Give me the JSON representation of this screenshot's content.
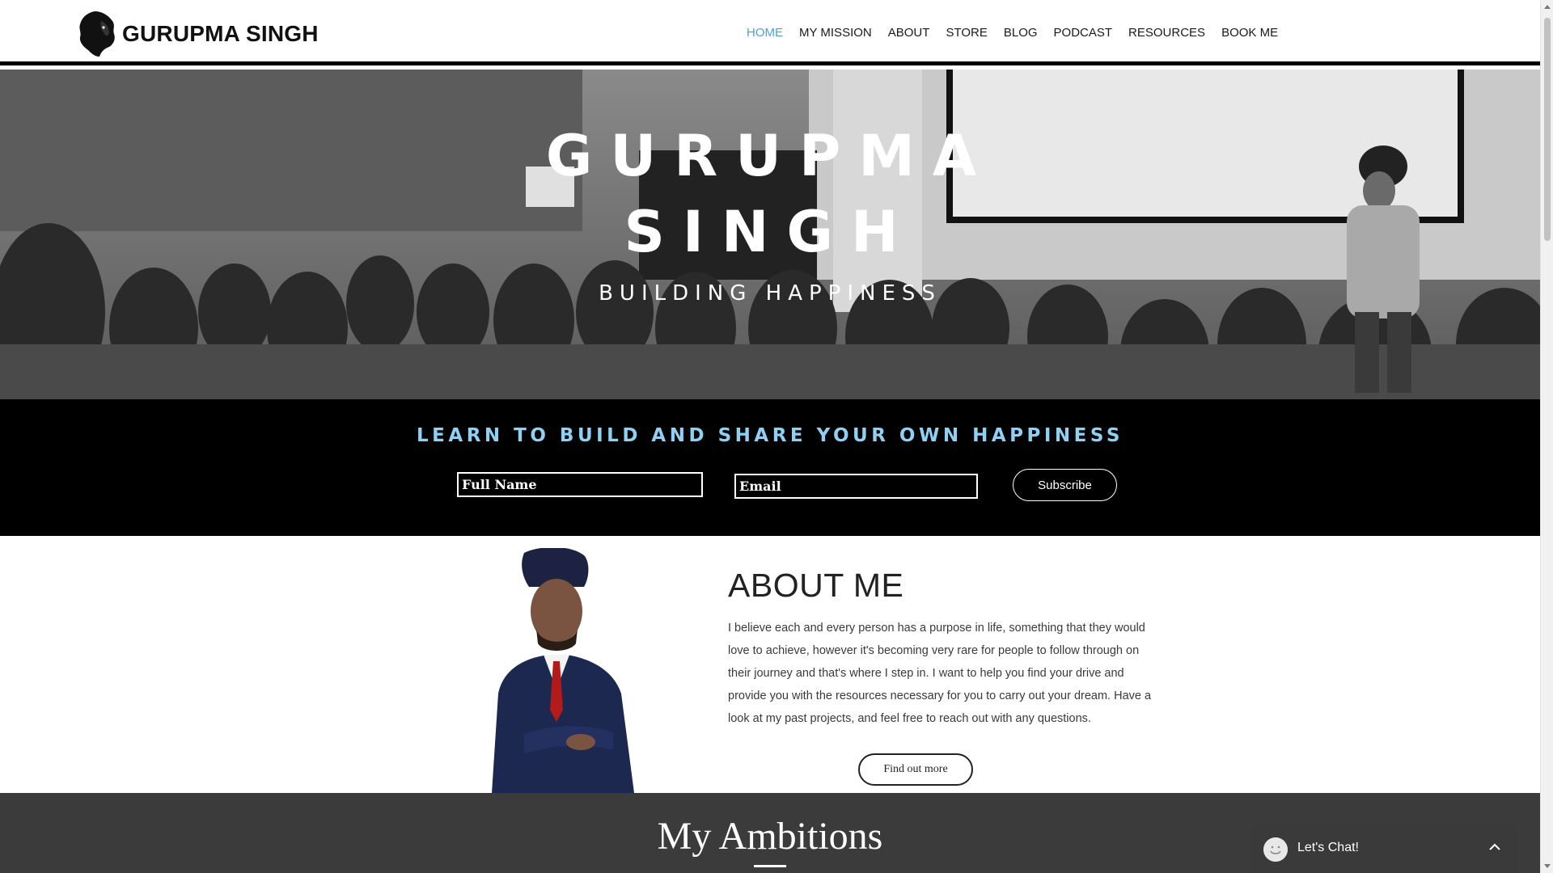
{
  "header": {
    "brand": "GURUPMA SINGH",
    "nav": [
      "HOME",
      "MY MISSION",
      "ABOUT",
      "STORE",
      "BLOG",
      "PODCAST",
      "RESOURCES",
      "BOOK ME"
    ],
    "active_nav": "HOME"
  },
  "hero": {
    "title_line1": "GURUPMA",
    "title_line2": "SINGH",
    "subtitle": "BUILDING HAPPINESS"
  },
  "subscribe": {
    "heading": "LEARN TO BUILD AND SHARE YOUR OWN HAPPINESS",
    "name_placeholder": "Full Name",
    "email_placeholder": "Email",
    "button": "Subscribe"
  },
  "about": {
    "title": "ABOUT ME",
    "text": "I believe each and every person has a purpose in life, something that they would love to achieve, however it's becoming very rare for people to follow through on their journey and that's where I step in. I want to help you find your drive and provide you with the resources necessary for you to carry out your dream. Have a look at my past projects, and feel free to reach out with any questions.",
    "button": "Find out more"
  },
  "ambitions": {
    "title": "My Ambitions"
  },
  "chat": {
    "label": "Let's Chat!"
  },
  "colors": {
    "nav_active": "#4aa3d8",
    "band_heading": "#8fd0f5",
    "ambitions_bg": "#3b3b3b"
  },
  "icons": [
    "lion-logo-icon",
    "chat-avatar-icon",
    "chevron-up-icon"
  ]
}
